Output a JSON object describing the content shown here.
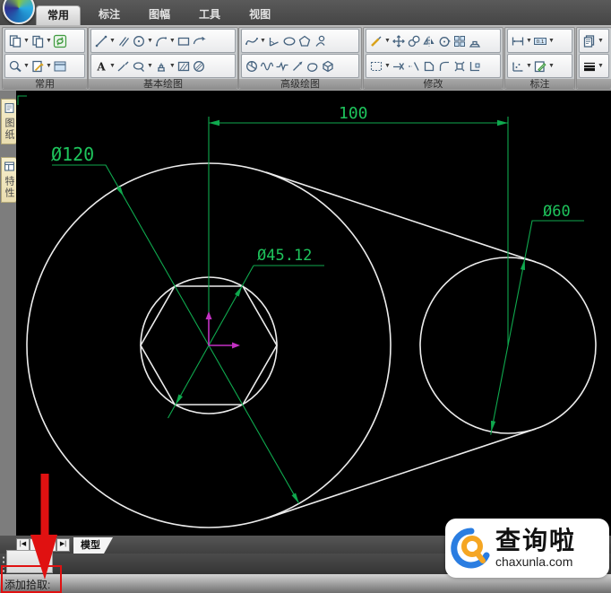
{
  "titlebar": {
    "tabs": [
      {
        "label": "常用",
        "active": true
      },
      {
        "label": "标注",
        "active": false
      },
      {
        "label": "图幅",
        "active": false
      },
      {
        "label": "工具",
        "active": false
      },
      {
        "label": "视图",
        "active": false
      }
    ]
  },
  "ribbon": {
    "groups": [
      {
        "label": "常用",
        "rows": [
          [
            {
              "icon": "paste",
              "dd": true
            },
            {
              "icon": "copy",
              "dd": true
            },
            {
              "icon": "refresh",
              "dd": false
            }
          ],
          [
            {
              "icon": "zoom",
              "dd": true
            },
            {
              "icon": "edit-drawing",
              "dd": true
            },
            {
              "icon": "window",
              "dd": false
            }
          ]
        ]
      },
      {
        "label": "基本绘图",
        "rows": [
          [
            {
              "icon": "line",
              "dd": true
            },
            {
              "icon": "parallel",
              "dd": false
            },
            {
              "icon": "circle",
              "dd": true
            },
            {
              "icon": "arc",
              "dd": true
            },
            {
              "icon": "rectangle",
              "dd": false
            },
            {
              "icon": "revision-cloud",
              "dd": false
            }
          ],
          [
            {
              "icon": "text",
              "dd": true
            },
            {
              "icon": "sketch",
              "dd": false
            },
            {
              "icon": "callout",
              "dd": true
            },
            {
              "icon": "section",
              "dd": true
            },
            {
              "icon": "hatch",
              "dd": false
            },
            {
              "icon": "hatch-circle",
              "dd": false
            }
          ]
        ]
      },
      {
        "label": "高级绘图",
        "rows": [
          [
            {
              "icon": "spline",
              "dd": true
            },
            {
              "icon": "angle",
              "dd": false
            },
            {
              "icon": "ellipse",
              "dd": false
            },
            {
              "icon": "polygon",
              "dd": false
            },
            {
              "icon": "insert-figure",
              "dd": false
            }
          ],
          [
            {
              "icon": "pie",
              "dd": false
            },
            {
              "icon": "wave",
              "dd": false
            },
            {
              "icon": "breakline",
              "dd": false
            },
            {
              "icon": "pointer",
              "dd": false
            },
            {
              "icon": "contour",
              "dd": false
            },
            {
              "icon": "block",
              "dd": false
            }
          ]
        ]
      },
      {
        "label": "修改",
        "rows": [
          [
            {
              "icon": "erase",
              "dd": true
            },
            {
              "icon": "move",
              "dd": false
            },
            {
              "icon": "copy-obj",
              "dd": false
            },
            {
              "icon": "mirror",
              "dd": false
            },
            {
              "icon": "rotate",
              "dd": false
            },
            {
              "icon": "array",
              "dd": false
            },
            {
              "icon": "offset",
              "dd": false
            }
          ],
          [
            {
              "icon": "select",
              "dd": true
            },
            {
              "icon": "trim",
              "dd": false
            },
            {
              "icon": "extend",
              "dd": false
            },
            {
              "icon": "chamfer",
              "dd": false
            },
            {
              "icon": "fillet",
              "dd": false
            },
            {
              "icon": "explode",
              "dd": false
            },
            {
              "icon": "corner",
              "dd": false
            }
          ]
        ]
      },
      {
        "label": "标注",
        "rows": [
          [
            {
              "icon": "dimension",
              "dd": true
            },
            {
              "icon": "tolerance",
              "dd": true
            }
          ],
          [
            {
              "icon": "coordinate",
              "dd": true
            },
            {
              "icon": "note-edit",
              "dd": true
            }
          ]
        ]
      },
      {
        "label": "",
        "rows": [
          [
            {
              "icon": "layer",
              "dd": true
            }
          ],
          [
            {
              "icon": "linewidth",
              "dd": true
            }
          ]
        ]
      }
    ]
  },
  "sidebar": {
    "tabs": [
      {
        "label": "图纸",
        "icon": "sheet"
      },
      {
        "label": "特性",
        "icon": "properties"
      }
    ]
  },
  "canvas": {
    "dim_labels": {
      "d120": "Ø120",
      "d45": "Ø45.12",
      "d60": "Ø60",
      "len100": "100"
    }
  },
  "bottombar": {
    "nav": [
      "|◀",
      "◀",
      "▶",
      "▶|"
    ],
    "model_tab": "模型"
  },
  "statusbar": {
    "prompt": "添加拾取:"
  },
  "watermark": {
    "title": "查询啦",
    "domain": "chaxunla.com"
  },
  "colors": {
    "dimension_green": "#0fa94e",
    "dimension_text_green": "#1ec45c",
    "geometry_white": "#ececec",
    "ucs_magenta": "#c230c2",
    "highlight_red": "#e01111"
  }
}
